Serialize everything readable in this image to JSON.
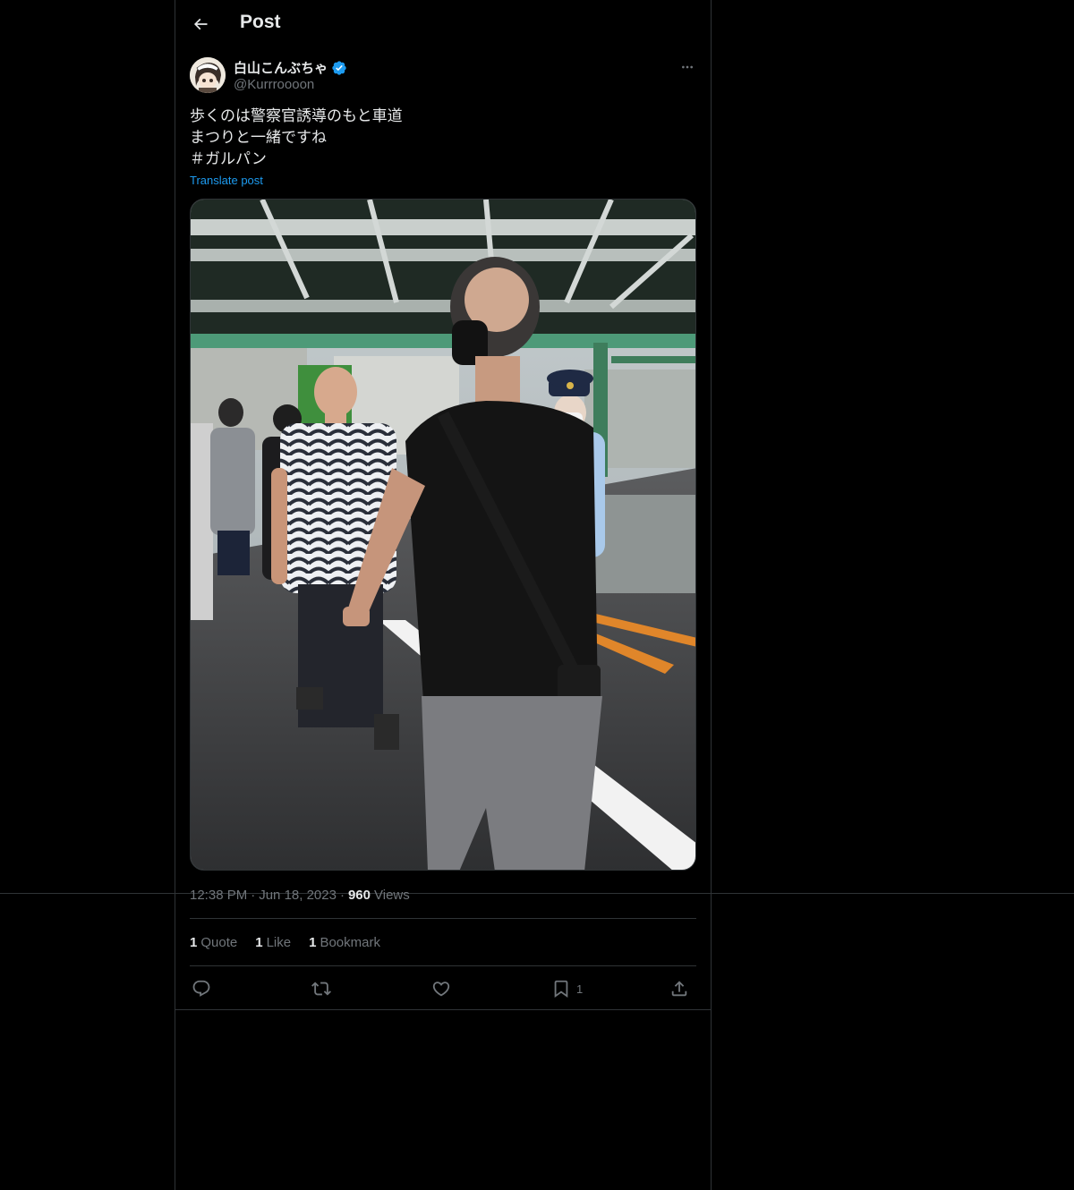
{
  "header": {
    "title": "Post",
    "back_icon": "arrow-left-icon"
  },
  "author": {
    "display_name": "白山こんぶちゃ",
    "handle": "@Kurrroooon",
    "verified": true,
    "verified_color": "#1d9bf0"
  },
  "tweet": {
    "lines": [
      "歩くのは警察官誘導のもと車道",
      "まつりと一緒ですね",
      "＃ガルパン"
    ],
    "translate_label": "Translate post"
  },
  "meta": {
    "time": "12:38 PM",
    "date": "Jun 18, 2023",
    "views_count": "960",
    "views_label": "Views",
    "separator": "·"
  },
  "stats": [
    {
      "count": "1",
      "label": "Quote"
    },
    {
      "count": "1",
      "label": "Like"
    },
    {
      "count": "1",
      "label": "Bookmark"
    }
  ],
  "actions": {
    "reply_icon": "reply-icon",
    "repost_icon": "repost-icon",
    "like_icon": "heart-icon",
    "bookmark_icon": "bookmark-icon",
    "bookmark_count": "1",
    "share_icon": "share-icon"
  },
  "colors": {
    "background": "#000000",
    "text": "#e7e9ea",
    "muted": "#71767b",
    "accent": "#1d9bf0",
    "border": "#2f3336"
  }
}
